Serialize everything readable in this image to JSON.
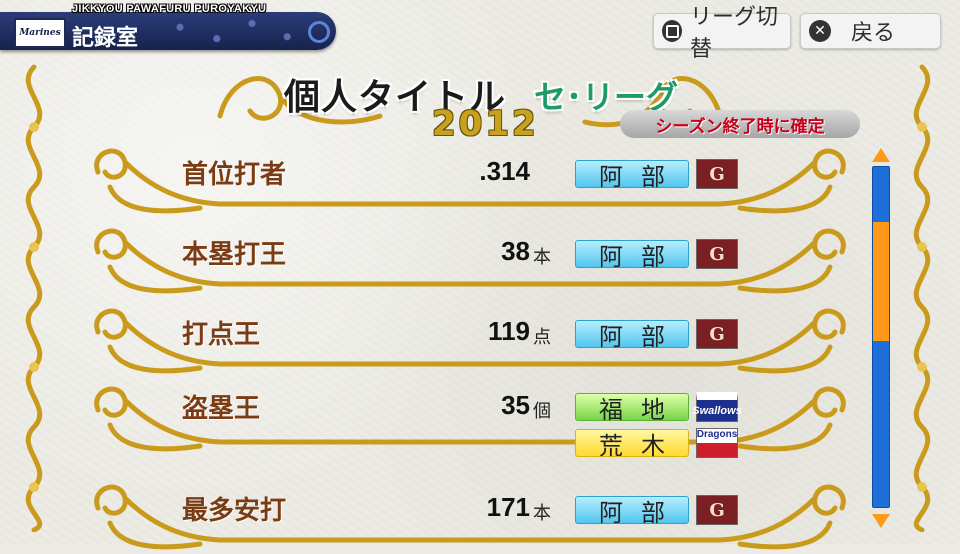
{
  "header": {
    "subtitle": "JIKKYOU PAWAFURU PUROYAKYU",
    "title": "記録室",
    "team_logo_text": "Marines"
  },
  "buttons": {
    "league_switch": "リーグ切替",
    "back": "戻る"
  },
  "page": {
    "title": "個人タイトル",
    "league": "セ･リーグ",
    "year": "2012",
    "notice": "シーズン終了時に確定"
  },
  "titles": [
    {
      "name": "首位打者",
      "value": ".314",
      "unit": "",
      "players": [
        {
          "name": "阿部",
          "color": "blue",
          "team": "giants"
        }
      ]
    },
    {
      "name": "本塁打王",
      "value": "38",
      "unit": "本",
      "players": [
        {
          "name": "阿部",
          "color": "blue",
          "team": "giants"
        }
      ]
    },
    {
      "name": "打点王",
      "value": "119",
      "unit": "点",
      "players": [
        {
          "name": "阿部",
          "color": "blue",
          "team": "giants"
        }
      ]
    },
    {
      "name": "盗塁王",
      "value": "35",
      "unit": "個",
      "players": [
        {
          "name": "福地",
          "color": "green",
          "team": "swallows"
        },
        {
          "name": "荒木",
          "color": "yellow",
          "team": "dragons"
        }
      ]
    },
    {
      "name": "最多安打",
      "value": "171",
      "unit": "本",
      "players": [
        {
          "name": "阿部",
          "color": "blue",
          "team": "giants"
        }
      ]
    }
  ],
  "team_logos": {
    "giants": "G",
    "swallows": "Swallows",
    "dragons": "Dragons"
  },
  "scroll": {
    "position": 0.25,
    "visible_fraction": 0.35
  },
  "colors": {
    "accent": "#ff9a18",
    "scroll": "#1f6fd8",
    "header": "#1b2a5c",
    "title_text": "#7a3c14"
  }
}
